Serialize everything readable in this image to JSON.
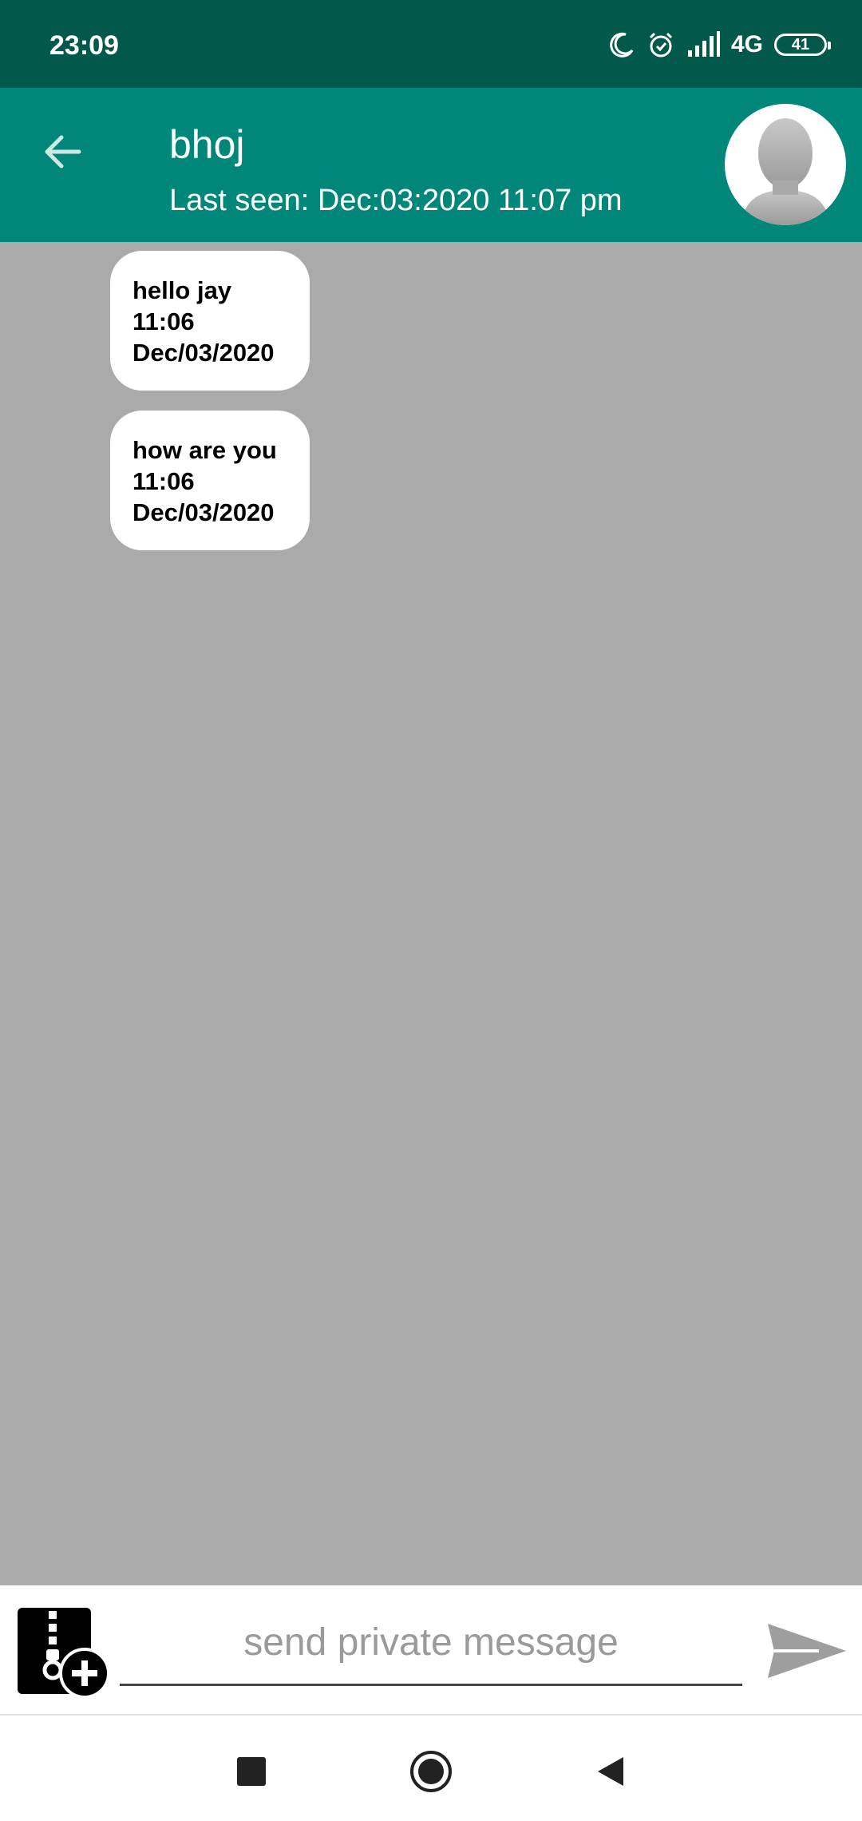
{
  "status_bar": {
    "time": "23:09",
    "network": "4G",
    "battery": "41",
    "icons": [
      "moon-icon",
      "alarm-icon",
      "signal-icon",
      "battery-icon"
    ]
  },
  "toolbar": {
    "back_icon": "arrow-left-icon",
    "contact_name": "bhoj",
    "last_seen": "Last seen: Dec:03:2020 11:07 pm",
    "avatar_icon": "person-silhouette-icon"
  },
  "messages": [
    {
      "text": "hello jay",
      "time": "11:06",
      "date": "Dec/03/2020"
    },
    {
      "text": "how are you",
      "time": "11:06",
      "date": "Dec/03/2020"
    }
  ],
  "input_bar": {
    "attach_icon": "zip-file-add-icon",
    "placeholder": "send private message",
    "value": "",
    "send_icon": "send-icon"
  },
  "nav_bar": {
    "icons": [
      "recent-apps-square-icon",
      "home-circle-icon",
      "back-triangle-icon"
    ]
  },
  "colors": {
    "status_bar": "#03584c",
    "toolbar": "#00877a",
    "chat_background": "#aaaaaa",
    "bubble": "#ffffff"
  }
}
